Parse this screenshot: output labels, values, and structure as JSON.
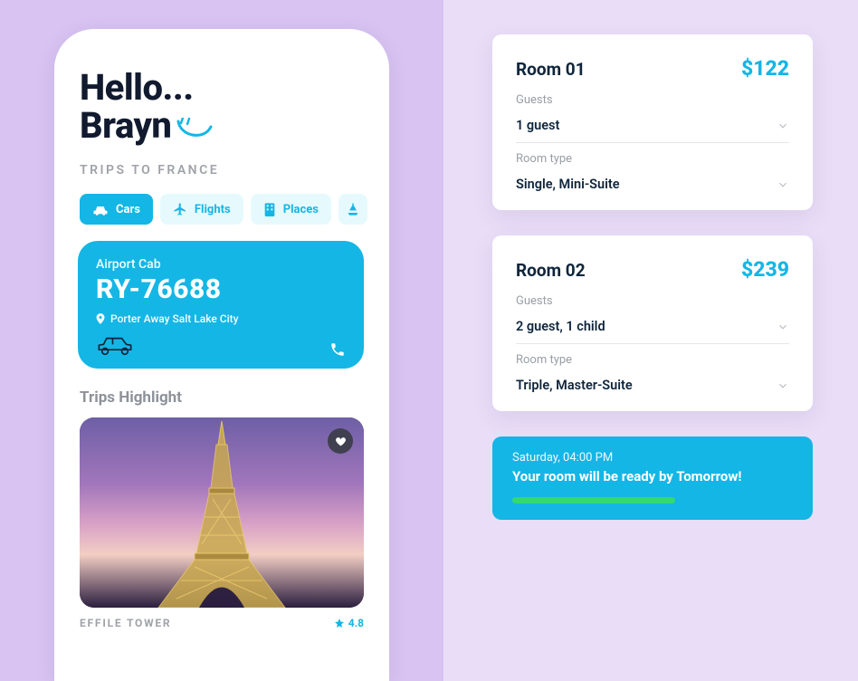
{
  "greeting": {
    "line1": "Hello...",
    "name": "Brayn"
  },
  "subtitle": "TRIPS  TO FRANCE",
  "tabs": [
    {
      "label": "Cars",
      "active": true
    },
    {
      "label": "Flights",
      "active": false
    },
    {
      "label": "Places",
      "active": false
    }
  ],
  "cab_card": {
    "title": "Airport Cab",
    "code": "RY-76688",
    "location": "Porter Away Salt Lake City"
  },
  "highlights": {
    "section_title": "Trips Highlight",
    "item": {
      "name": "EFFILE TOWER",
      "rating": "4.8"
    }
  },
  "rooms": [
    {
      "title": "Room 01",
      "price": "$122",
      "guests_label": "Guests",
      "guests_value": "1 guest",
      "type_label": "Room type",
      "type_value": "Single, Mini-Suite"
    },
    {
      "title": "Room 02",
      "price": "$239",
      "guests_label": "Guests",
      "guests_value": "2 guest, 1 child",
      "type_label": "Room type",
      "type_value": "Triple, Master-Suite"
    }
  ],
  "notice": {
    "time": "Saturday, 04:00 PM",
    "message": "Your room will be ready by Tomorrow!",
    "progress_pct": 58
  }
}
